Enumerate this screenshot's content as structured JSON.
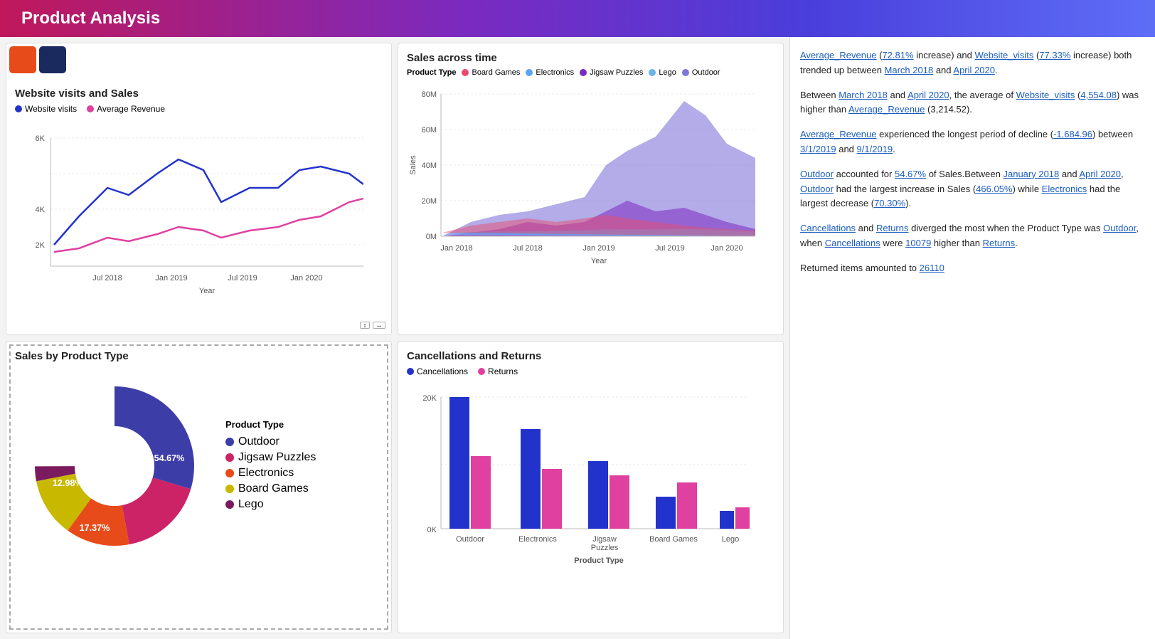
{
  "header": {
    "title": "Product Analysis"
  },
  "charts": {
    "website_visits_sales": {
      "title": "Website visits and Sales",
      "legend": [
        {
          "label": "Website visits",
          "color": "#2233cc"
        },
        {
          "label": "Average Revenue",
          "color": "#e040a0"
        }
      ]
    },
    "sales_across_time": {
      "title": "Sales across time",
      "product_type_label": "Product Type",
      "legend": [
        {
          "label": "Board Games",
          "color": "#e84b6e"
        },
        {
          "label": "Electronics",
          "color": "#5ba3f5"
        },
        {
          "label": "Jigsaw Puzzles",
          "color": "#7b2abf"
        },
        {
          "label": "Lego",
          "color": "#6bb5e8"
        },
        {
          "label": "Outdoor",
          "color": "#8075d8"
        }
      ]
    },
    "sales_by_product": {
      "title": "Sales by Product Type",
      "segments": [
        {
          "label": "Outdoor",
          "color": "#3d3da8",
          "pct": "54.67%",
          "value": 54.67
        },
        {
          "label": "Jigsaw Puzzles",
          "color": "#cc2266",
          "pct": "17.37%",
          "value": 17.37
        },
        {
          "label": "Electronics",
          "color": "#e84b1a",
          "pct": "12.98%",
          "value": 12.98
        },
        {
          "label": "Board Games",
          "color": "#c8b800",
          "pct": "11.96%",
          "value": 11.96
        },
        {
          "label": "Lego",
          "color": "#7b1a5e",
          "pct": "2.99%",
          "value": 2.99
        }
      ]
    },
    "cancellations_returns": {
      "title": "Cancellations and Returns",
      "legend": [
        {
          "label": "Cancellations",
          "color": "#2233cc"
        },
        {
          "label": "Returns",
          "color": "#e040a0"
        }
      ],
      "bars": [
        {
          "category": "Outdoor",
          "cancellations": 20500,
          "returns": 10200
        },
        {
          "category": "Electronics",
          "cancellations": 14500,
          "returns": 8500
        },
        {
          "category": "Jigsaw\nPuzzles",
          "cancellations": 9500,
          "returns": 7500
        },
        {
          "category": "Board Games",
          "cancellations": 4500,
          "returns": 6500
        },
        {
          "category": "Lego",
          "cancellations": 2500,
          "returns": 3000
        }
      ],
      "x_label": "Product Type",
      "y_labels": [
        "0K",
        "20K"
      ]
    }
  },
  "insights": [
    {
      "text_parts": [
        {
          "text": "Average_Revenue",
          "link": true
        },
        {
          "text": " ("
        },
        {
          "text": "72.81%",
          "link": true
        },
        {
          "text": " increase) and "
        },
        {
          "text": "Website_visits",
          "link": true
        },
        {
          "text": " ("
        },
        {
          "text": "77.33%",
          "link": true
        },
        {
          "text": " increase) both trended up between "
        },
        {
          "text": "March 2018",
          "link": true
        },
        {
          "text": " and "
        },
        {
          "text": "April 2020",
          "link": true
        },
        {
          "text": "."
        }
      ]
    },
    {
      "text_parts": [
        {
          "text": "Between "
        },
        {
          "text": "March 2018",
          "link": true
        },
        {
          "text": " and "
        },
        {
          "text": "April 2020",
          "link": true
        },
        {
          "text": ", the average of "
        },
        {
          "text": "Website_visits",
          "link": true
        },
        {
          "text": " ("
        },
        {
          "text": "4,554.08",
          "link": true
        },
        {
          "text": ") was higher than "
        },
        {
          "text": "Average_Revenue",
          "link": true
        },
        {
          "text": " (3,214.52)."
        }
      ]
    },
    {
      "text_parts": [
        {
          "text": "Average_Revenue",
          "link": true
        },
        {
          "text": " experienced the longest period of decline ("
        },
        {
          "text": "-1,684.96",
          "link": true
        },
        {
          "text": ") between "
        },
        {
          "text": "3/1/2019",
          "link": true
        },
        {
          "text": " and "
        },
        {
          "text": "9/1/2019",
          "link": true
        },
        {
          "text": "."
        }
      ]
    },
    {
      "text_parts": [
        {
          "text": "Outdoor",
          "link": true
        },
        {
          "text": " accounted for "
        },
        {
          "text": "54.67%",
          "link": true
        },
        {
          "text": " of Sales.Between "
        },
        {
          "text": "January 2018",
          "link": true
        },
        {
          "text": " and "
        },
        {
          "text": "April 2020",
          "link": true
        },
        {
          "text": ", "
        },
        {
          "text": "Outdoor",
          "link": true
        },
        {
          "text": " had the largest increase in Sales ("
        },
        {
          "text": "466.05%",
          "link": true
        },
        {
          "text": ") while "
        },
        {
          "text": "Electronics",
          "link": true
        },
        {
          "text": " had the largest decrease ("
        },
        {
          "text": "70.30%",
          "link": true
        },
        {
          "text": ")."
        }
      ]
    },
    {
      "text_parts": [
        {
          "text": "Cancellations",
          "link": true
        },
        {
          "text": " and "
        },
        {
          "text": "Returns",
          "link": true
        },
        {
          "text": " diverged the most when the Product Type was "
        },
        {
          "text": "Outdoor",
          "link": true
        },
        {
          "text": ", when "
        },
        {
          "text": "Cancellations",
          "link": true
        },
        {
          "text": " were "
        },
        {
          "text": "10079",
          "link": true
        },
        {
          "text": " higher than "
        },
        {
          "text": "Returns",
          "link": true
        },
        {
          "text": "."
        }
      ]
    },
    {
      "text_parts": [
        {
          "text": "Returned items amounted to "
        },
        {
          "text": "26110",
          "link": true
        }
      ]
    }
  ]
}
